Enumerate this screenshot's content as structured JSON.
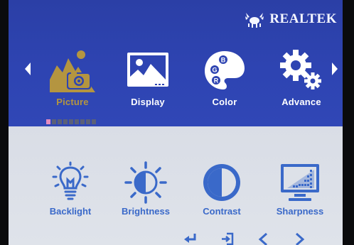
{
  "brand": {
    "name": "REALTEK"
  },
  "colors": {
    "top_panel": "#2e44b2",
    "bottom_panel": "#dde1e8",
    "active_label": "#b49540",
    "sub_icon": "#3a69c9",
    "page_dot_active": "#e48bbf"
  },
  "main_menu": {
    "items": [
      {
        "label": "Picture",
        "icon": "picture-mountain-icon",
        "active": true
      },
      {
        "label": "Display",
        "icon": "display-image-icon",
        "active": false
      },
      {
        "label": "Color",
        "icon": "color-palette-icon",
        "active": false
      },
      {
        "label": "Advance",
        "icon": "advance-gears-icon",
        "active": false
      }
    ],
    "page_indicator": {
      "total": 9,
      "current": 1
    }
  },
  "sub_menu": {
    "items": [
      {
        "label": "Backlight",
        "icon": "lightbulb-icon"
      },
      {
        "label": "Brightness",
        "icon": "sun-icon"
      },
      {
        "label": "Contrast",
        "icon": "contrast-icon"
      },
      {
        "label": "Sharpness",
        "icon": "sharpness-monitor-icon"
      }
    ]
  },
  "nav_buttons": [
    "enter-icon",
    "exit-icon",
    "left-icon",
    "right-icon"
  ]
}
